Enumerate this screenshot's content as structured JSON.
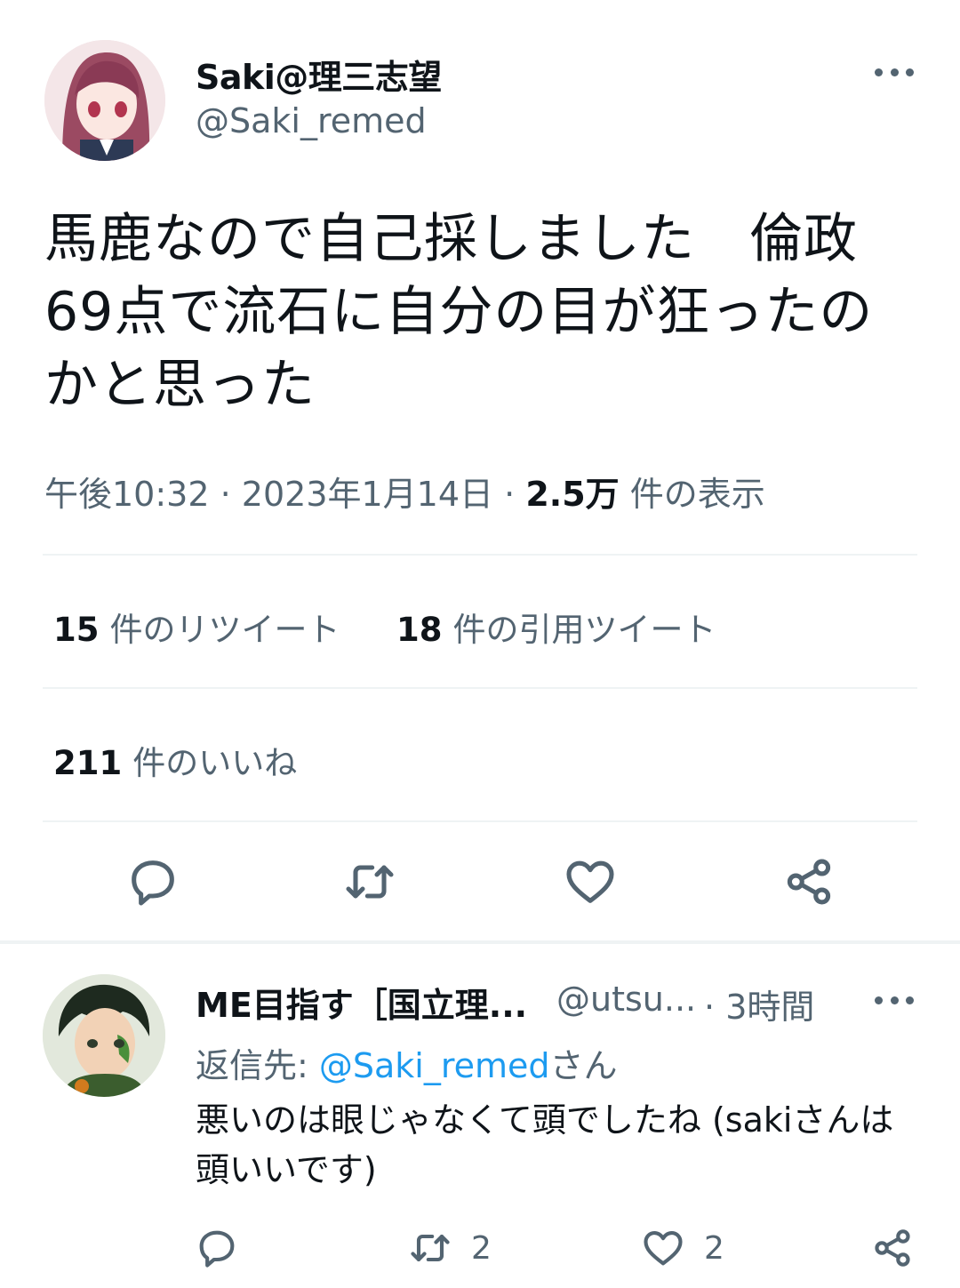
{
  "tweet": {
    "author_name": "Saki@理三志望",
    "author_handle": "@Saki_remed",
    "text": "馬鹿なので自己採しました　倫政69点で流石に自分の目が狂ったのかと思った",
    "time": "午後10:32",
    "date": "2023年1月14日",
    "separator": "·",
    "views_count": "2.5万",
    "views_label": "件の表示",
    "retweets_count": "15",
    "retweets_label": "件のリツイート",
    "quotes_count": "18",
    "quotes_label": "件の引用ツイート",
    "likes_count": "211",
    "likes_label": "件のいいね"
  },
  "actions": {
    "reply_icon": "speech-bubble-icon",
    "retweet_icon": "retweet-icon",
    "like_icon": "heart-icon",
    "share_icon": "share-icon"
  },
  "reply": {
    "author_name": "ME目指す［国立理...",
    "author_handle": "@utsu...",
    "separator": "·",
    "time": "3時間",
    "reply_to_label": "返信先: ",
    "reply_to_mention": "@Saki_remed",
    "reply_to_suffix": "さん",
    "text": "悪いのは眼じゃなくて頭でしたね (sakiさんは頭いいです)",
    "retweet_count": "2",
    "like_count": "2"
  },
  "colors": {
    "text": "#0f1419",
    "secondary": "#536471",
    "link": "#1d9bf0",
    "divider": "#eff3f4"
  }
}
